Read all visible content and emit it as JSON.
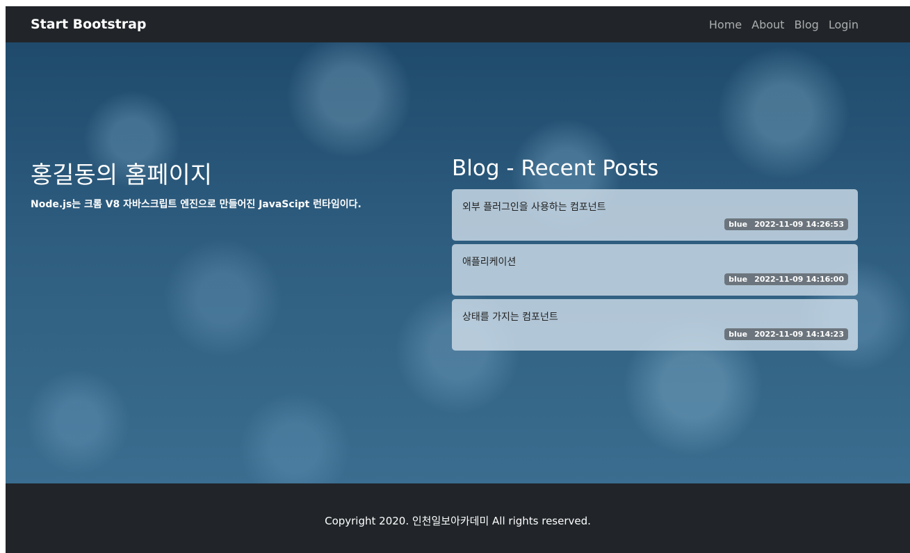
{
  "navbar": {
    "brand": "Start Bootstrap",
    "links": [
      "Home",
      "About",
      "Blog",
      "Login"
    ]
  },
  "hero": {
    "title": "홍길동의 홈페이지",
    "description": "Node.js는 크롬 V8 자바스크립트 엔진으로 만들어진 JavaScipt 런타임이다."
  },
  "blog": {
    "heading": "Blog - Recent Posts",
    "posts": [
      {
        "title": "외부 플러그인을 사용하는 컴포넌트",
        "author": "blue",
        "date": "2022-11-09 14:26:53"
      },
      {
        "title": "애플리케이션",
        "author": "blue",
        "date": "2022-11-09 14:16:00"
      },
      {
        "title": "상태를 가지는 컴포넌트",
        "author": "blue",
        "date": "2022-11-09 14:14:23"
      }
    ]
  },
  "footer": {
    "copyright": "Copyright 2020. 인천일보아카데미 All rights reserved."
  },
  "colors": {
    "navbar_bg": "#212529",
    "footer_bg": "#212529",
    "badge_bg": "#6c757d",
    "hero_bg": "#2c5878"
  }
}
